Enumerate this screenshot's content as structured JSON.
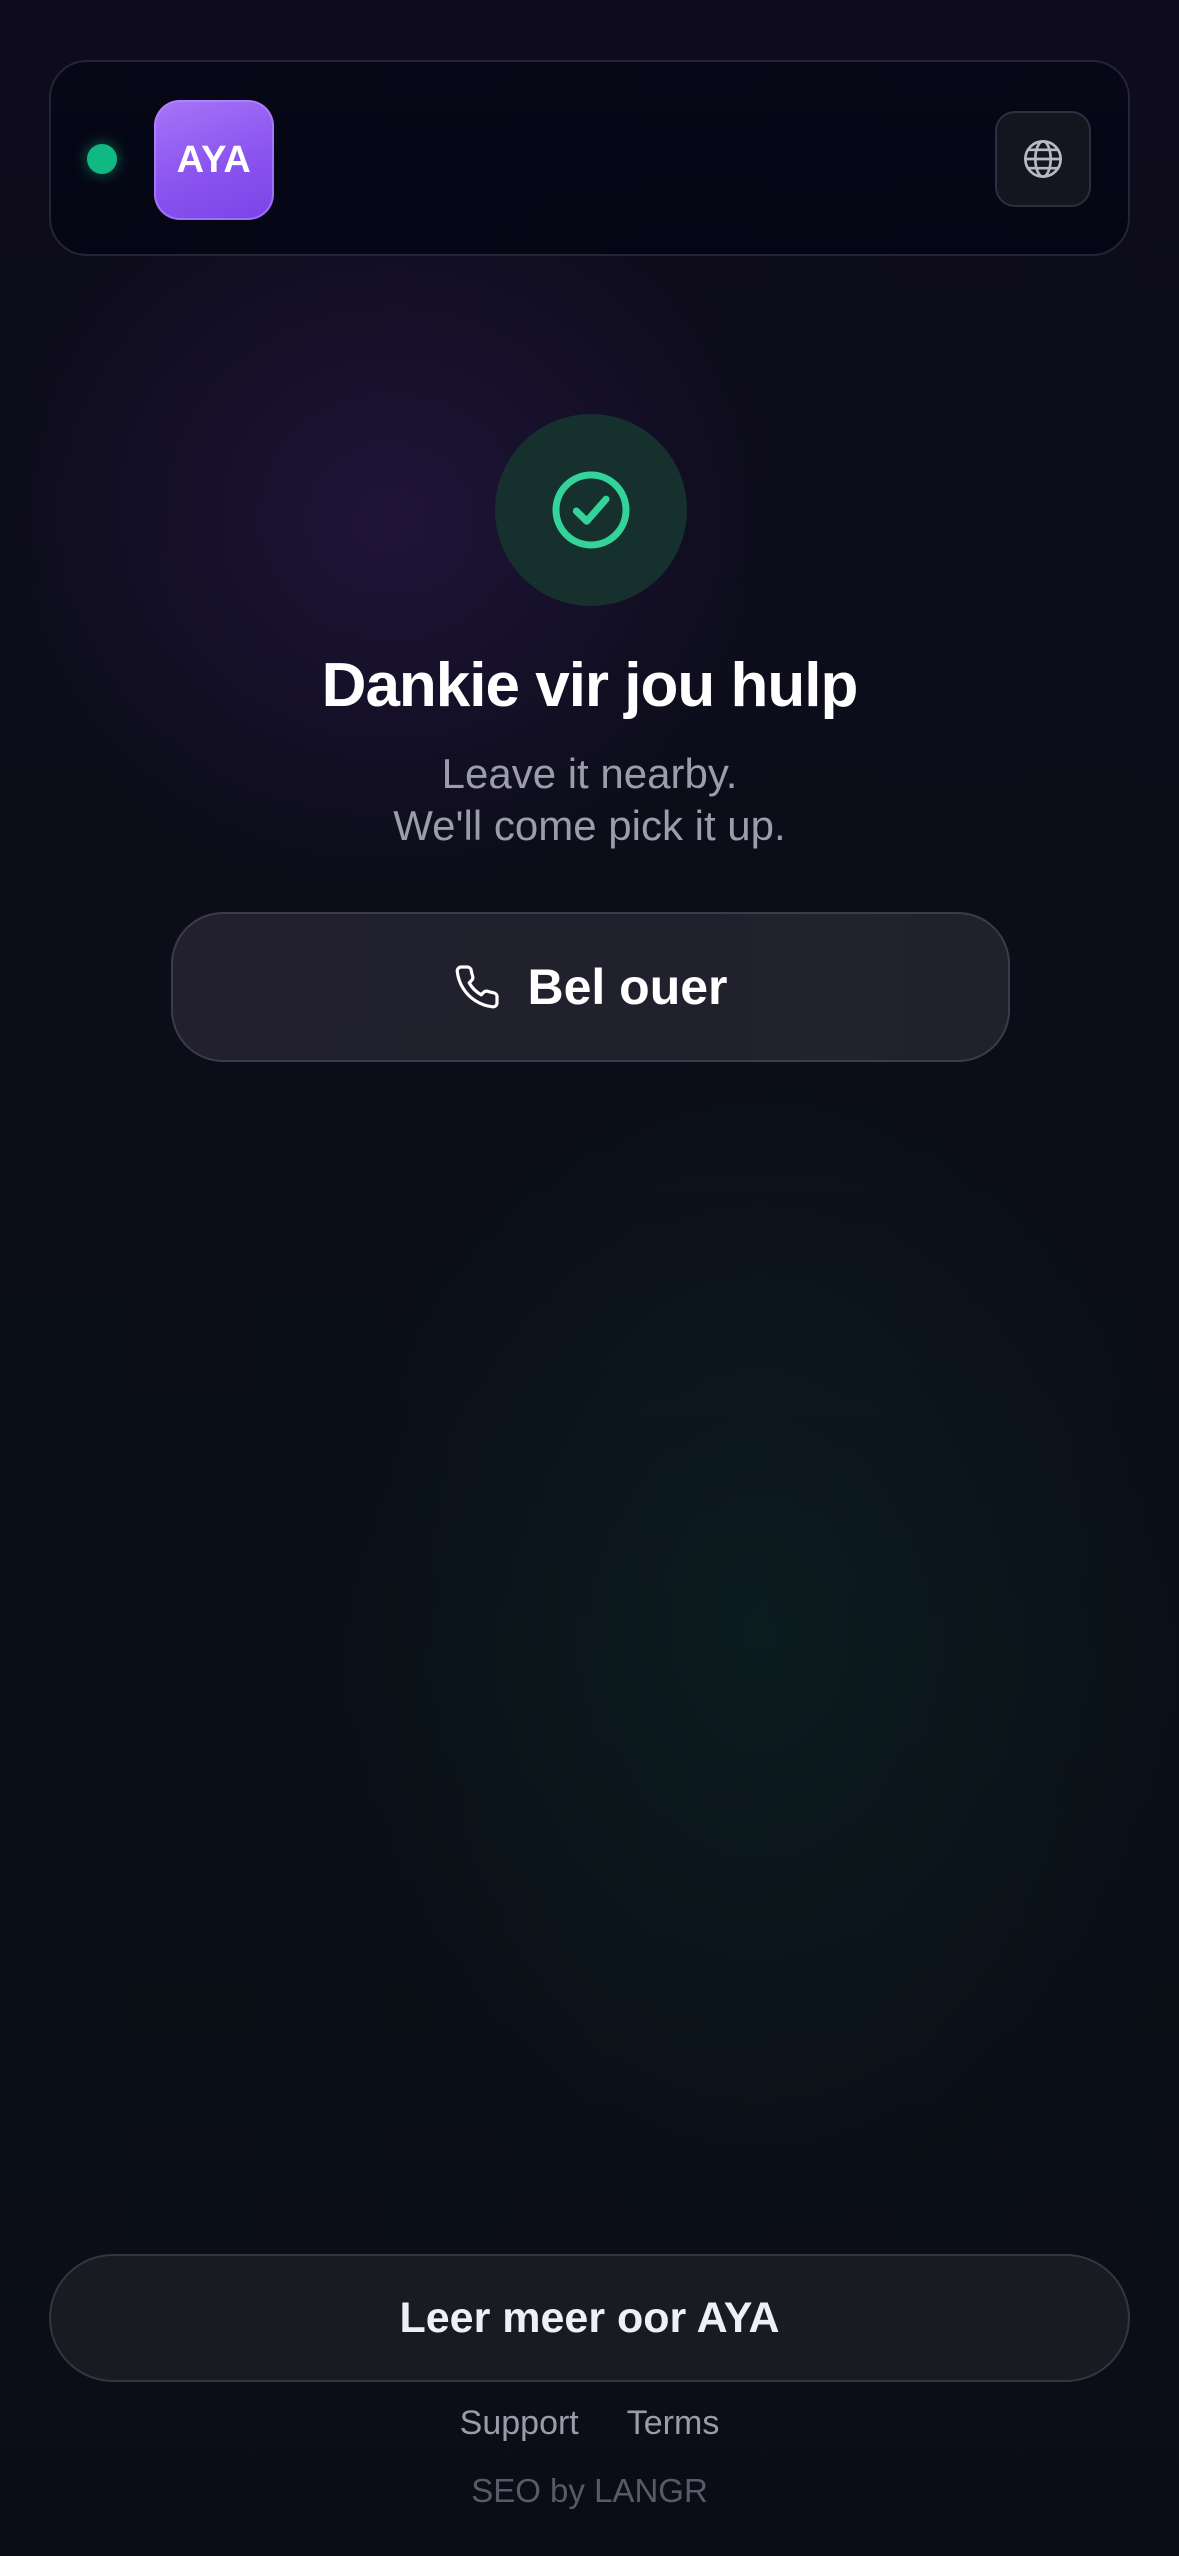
{
  "header": {
    "logo_text": "AYA",
    "status_indicator": "online",
    "status_color": "#10b981",
    "language_icon": "globe-icon"
  },
  "success": {
    "icon": "check-circle-icon",
    "icon_color": "#34d399",
    "title": "Dankie vir jou hulp",
    "subtitle_line1": "Leave it nearby.",
    "subtitle_line2": "We'll come pick it up."
  },
  "call_button": {
    "icon": "phone-icon",
    "label": "Bel ouer"
  },
  "footer": {
    "learn_more_label": "Leer meer oor AYA",
    "links": [
      "Support",
      "Terms"
    ],
    "credit": "SEO by LANGR"
  },
  "colors": {
    "accent_purple": "#8b54f0",
    "accent_green": "#34d399",
    "background": "#0b0d18"
  }
}
